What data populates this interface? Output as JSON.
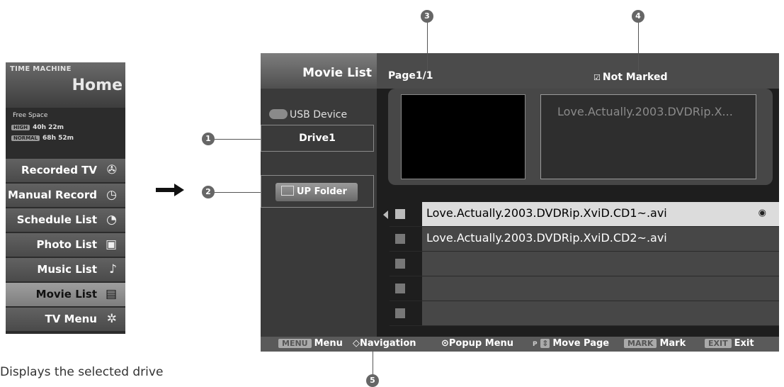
{
  "time_machine": {
    "title": "TIME MACHINE",
    "home": "Home",
    "free_space": "Free Space",
    "rows": [
      {
        "badge": "HIGH",
        "value": "40h 22m"
      },
      {
        "badge": "NORMAL",
        "value": "68h 52m"
      }
    ],
    "items": [
      {
        "label": "Recorded TV",
        "icon": "✇"
      },
      {
        "label": "Manual Record",
        "icon": "◷"
      },
      {
        "label": "Schedule List",
        "icon": "◔"
      },
      {
        "label": "Photo List",
        "icon": "▣"
      },
      {
        "label": "Music List",
        "icon": "♪"
      },
      {
        "label": "Movie List",
        "icon": "▤"
      },
      {
        "label": "TV Menu",
        "icon": "✲"
      }
    ]
  },
  "movie_list": {
    "title": "Movie List",
    "usb_device": "USB Device",
    "drive": "Drive1",
    "up_folder": "UP Folder",
    "page": "Page1/1",
    "marked_icon": "☑",
    "not_marked": "Not Marked",
    "preview_title": "Love.Actually.2003.DVDRip.X...",
    "files": [
      "Love.Actually.2003.DVDRip.XviD.CD1~.avi",
      "Love.Actually.2003.DVDRip.XviD.CD2~.avi",
      "",
      "",
      ""
    ],
    "selected_marker": "◉"
  },
  "footer": {
    "menu_key": "MENU",
    "menu": "Menu",
    "nav_icon": "◇",
    "navigation": "Navigation",
    "popup_icon": "⊙",
    "popup": "Popup Menu",
    "p_label": "P",
    "move_icon": "⇕",
    "move_page": "Move Page",
    "mark_key": "MARK",
    "mark": "Mark",
    "exit_key": "EXIT",
    "exit": "Exit"
  },
  "callouts": [
    "1",
    "2",
    "3",
    "4",
    "5"
  ],
  "caption": "Displays the selected drive"
}
